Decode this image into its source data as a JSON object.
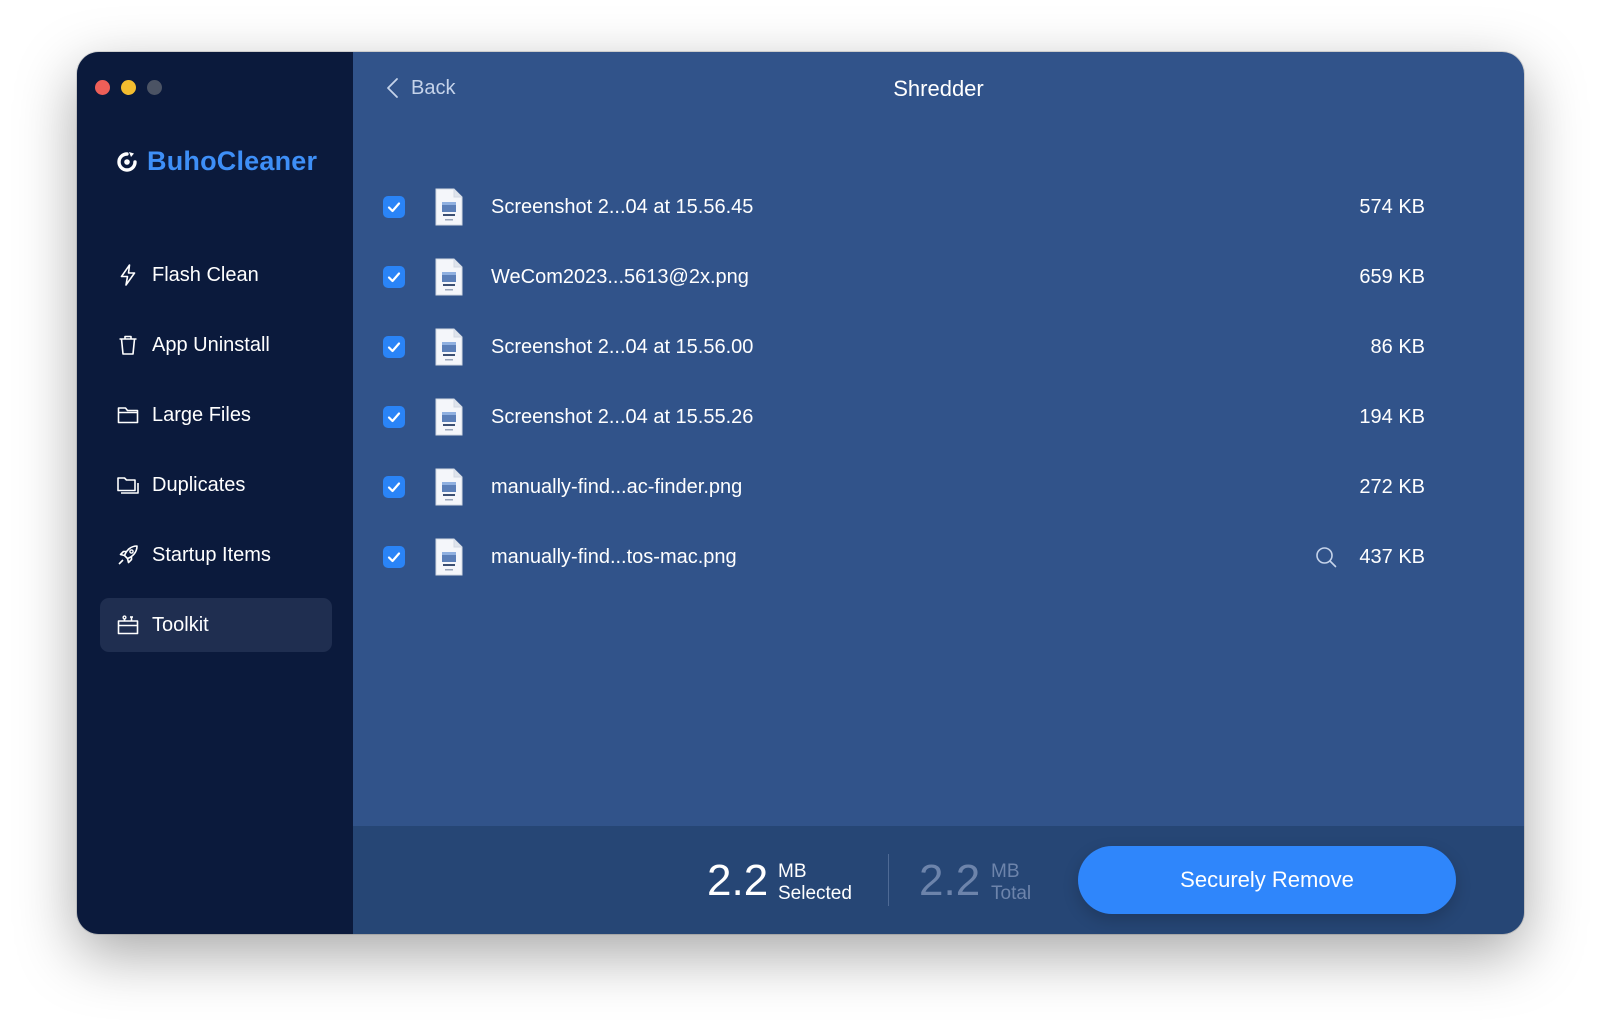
{
  "app": {
    "name": "BuhoCleaner"
  },
  "sidebar": {
    "items": [
      {
        "label": "Flash Clean",
        "icon": "bolt-icon",
        "active": false
      },
      {
        "label": "App Uninstall",
        "icon": "trash-icon",
        "active": false
      },
      {
        "label": "Large Files",
        "icon": "folder-icon",
        "active": false
      },
      {
        "label": "Duplicates",
        "icon": "duplicate-folder-icon",
        "active": false
      },
      {
        "label": "Startup Items",
        "icon": "rocket-icon",
        "active": false
      },
      {
        "label": "Toolkit",
        "icon": "toolbox-icon",
        "active": true
      }
    ]
  },
  "header": {
    "back_label": "Back",
    "title": "Shredder"
  },
  "files": [
    {
      "name": "Screenshot 2...04 at 15.56.45",
      "size": "574 KB",
      "checked": true
    },
    {
      "name": "WeCom2023...5613@2x.png",
      "size": "659 KB",
      "checked": true
    },
    {
      "name": "Screenshot 2...04 at 15.56.00",
      "size": "86 KB",
      "checked": true
    },
    {
      "name": "Screenshot 2...04 at 15.55.26",
      "size": "194 KB",
      "checked": true
    },
    {
      "name": "manually-find...ac-finder.png",
      "size": "272 KB",
      "checked": true
    },
    {
      "name": "manually-find...tos-mac.png",
      "size": "437 KB",
      "checked": true,
      "show_reveal": true
    }
  ],
  "footer": {
    "selected_value": "2.2",
    "selected_unit": "MB",
    "selected_label": "Selected",
    "total_value": "2.2",
    "total_unit": "MB",
    "total_label": "Total",
    "remove_label": "Securely Remove"
  },
  "colors": {
    "sidebar_bg": "#0b1a3c",
    "main_bg": "#31538a",
    "footer_bg": "#264675",
    "accent": "#2f86fb",
    "brand": "#3e8ff7"
  }
}
